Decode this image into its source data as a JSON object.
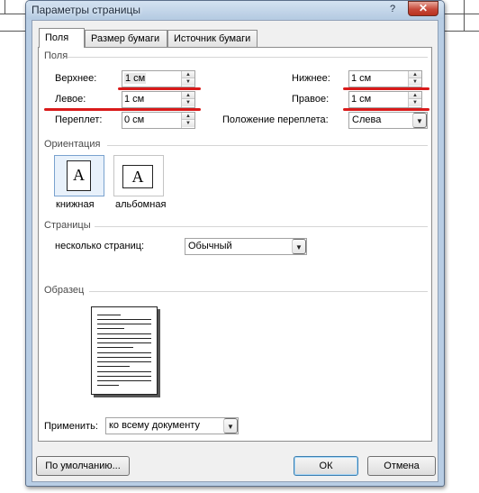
{
  "window": {
    "title": "Параметры страницы",
    "help_glyph": "?",
    "close_glyph": "✕"
  },
  "tabs": [
    {
      "label": "Поля",
      "active": true
    },
    {
      "label": "Размер бумаги",
      "active": false
    },
    {
      "label": "Источник бумаги",
      "active": false
    }
  ],
  "margins": {
    "group_label": "Поля",
    "top": {
      "label": "Верхнее:",
      "value": "1 см"
    },
    "bottom": {
      "label": "Нижнее:",
      "value": "1 см"
    },
    "left": {
      "label": "Левое:",
      "value": "1 см"
    },
    "right": {
      "label": "Правое:",
      "value": "1 см"
    },
    "gutter": {
      "label": "Переплет:",
      "value": "0 см"
    },
    "gutter_pos": {
      "label": "Положение переплета:",
      "value": "Слева"
    }
  },
  "orientation": {
    "group_label": "Ориентация",
    "portrait": {
      "label": "книжная",
      "glyph": "A",
      "selected": true
    },
    "landscape": {
      "label": "альбомная",
      "glyph": "A",
      "selected": false
    }
  },
  "pages": {
    "group_label": "Страницы",
    "multiple_label": "несколько страниц:",
    "multiple_value": "Обычный"
  },
  "preview": {
    "group_label": "Образец"
  },
  "apply": {
    "label": "Применить:",
    "value": "ко всему документу"
  },
  "buttons": {
    "default": "По умолчанию...",
    "ok": "ОК",
    "cancel": "Отмена"
  },
  "icons": {
    "spin_up": "▲",
    "spin_down": "▼",
    "dropdown": "▼"
  },
  "colors": {
    "annotation_red": "#d91a1a",
    "frame": "#b8cde4",
    "close_button": "#c7493a"
  }
}
